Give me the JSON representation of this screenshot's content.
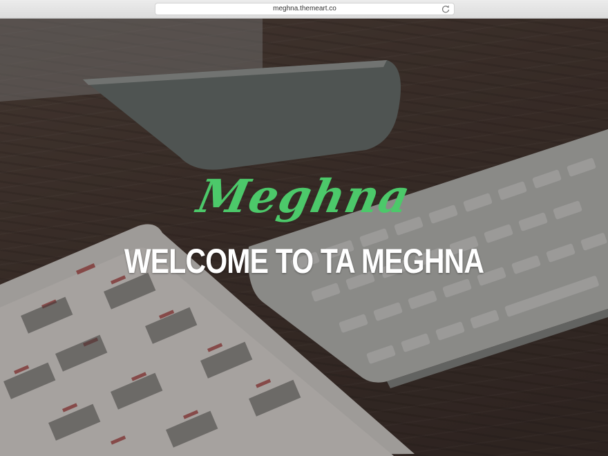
{
  "browser": {
    "url": "meghna.themeart.co"
  },
  "hero": {
    "brand": "Meghna",
    "headline": "WELCOME TO TA MEGHNA"
  },
  "colors": {
    "brand_green": "#4cc96a",
    "headline_white": "#ffffff"
  },
  "icons": {
    "reload": "reload-icon"
  }
}
